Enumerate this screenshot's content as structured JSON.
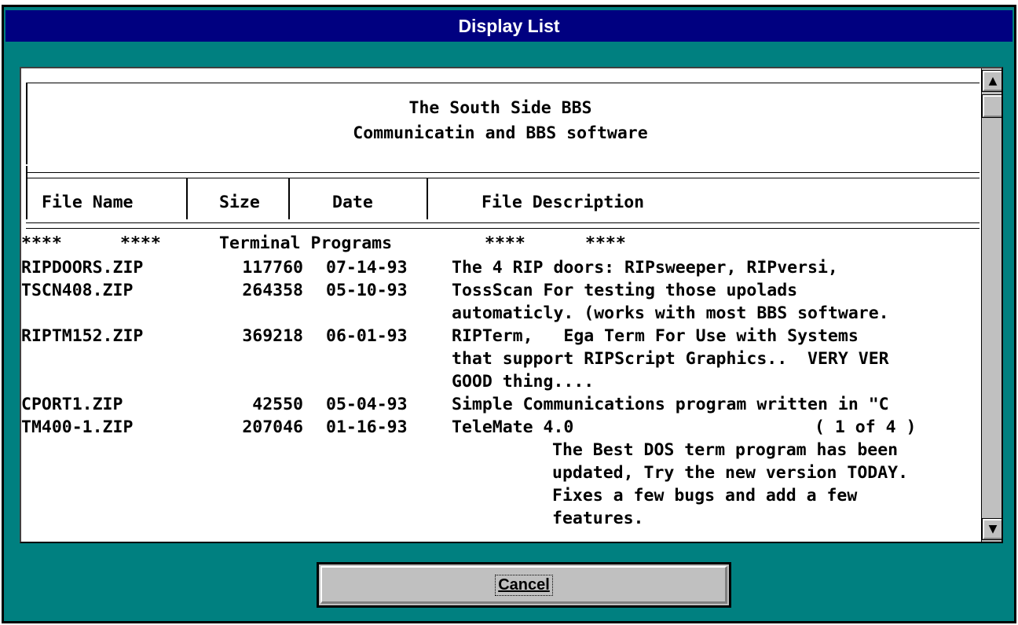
{
  "window": {
    "title": "Display List"
  },
  "banner": {
    "line1": "The South Side BBS",
    "line2": "Communicatin and BBS software"
  },
  "columns": {
    "file_name": "File Name",
    "size": "Size",
    "date": "Date",
    "description": "File Description"
  },
  "category": {
    "stars_left_1": "****",
    "stars_left_2": "****",
    "label": "Terminal Programs",
    "stars_right_1": "****",
    "stars_right_2": "****"
  },
  "files": [
    {
      "name": "RIPDOORS.ZIP",
      "size": "117760",
      "date": "07-14-93",
      "desc": "The 4 RIP doors: RIPsweeper, RIPversi,"
    },
    {
      "name": "TSCN408.ZIP",
      "size": "264358",
      "date": "05-10-93",
      "desc": "TossScan For testing those upolads"
    },
    {
      "desc": "automaticly. (works with most BBS software."
    },
    {
      "name": "RIPTM152.ZIP",
      "size": "369218",
      "date": "06-01-93",
      "desc": "RIPTerm,   Ega Term For Use with Systems"
    },
    {
      "desc": "that support RIPScript Graphics..  VERY VER"
    },
    {
      "desc": "GOOD thing...."
    },
    {
      "name": "CPORT1.ZIP",
      "size": "42550",
      "date": "05-04-93",
      "desc": "Simple Communications program written in \"C"
    },
    {
      "name": "TM400-1.ZIP",
      "size": "207046",
      "date": "01-16-93",
      "desc": "TeleMate 4.0",
      "extra": "( 1 of 4 )"
    },
    {
      "desc": "The Best DOS term program has been",
      "indent": true
    },
    {
      "desc": "updated, Try the new version TODAY.",
      "indent": true
    },
    {
      "desc": "Fixes a few bugs and add a few",
      "indent": true
    },
    {
      "desc": "features.",
      "indent": true
    }
  ],
  "scrollbar": {
    "up_icon": "up-arrow",
    "down_icon": "down-arrow"
  },
  "buttons": {
    "cancel": "Cancel"
  },
  "colors": {
    "dialog_bg": "#008080",
    "title_bg": "#000080",
    "list_bg": "#ffffff",
    "button_face": "#c0c0c0"
  }
}
